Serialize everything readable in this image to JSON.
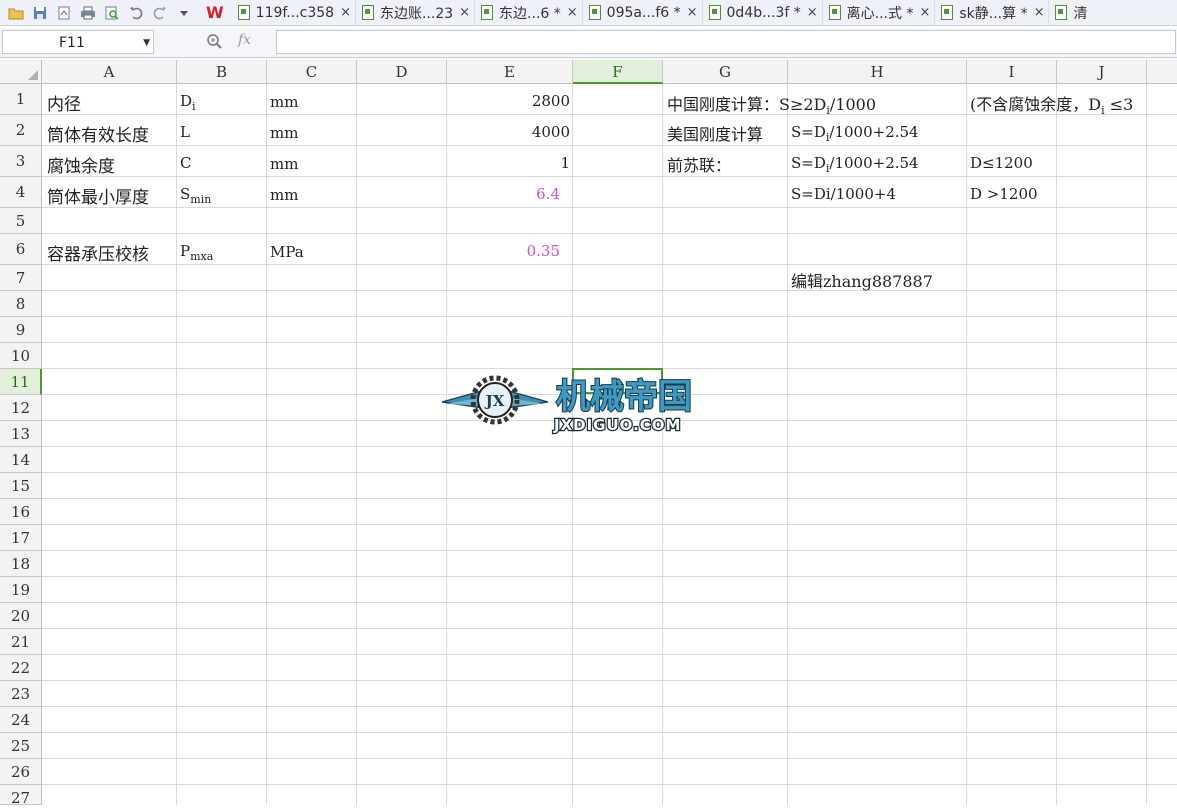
{
  "tabs": [
    {
      "label": "119f...c358",
      "close": "×"
    },
    {
      "label": "东边账...23",
      "close": "×"
    },
    {
      "label": "东边...6 *",
      "close": "×"
    },
    {
      "label": "095a...f6 *",
      "close": "×"
    },
    {
      "label": "0d4b...3f *",
      "close": "×"
    },
    {
      "label": "离心...式 *",
      "close": "×"
    },
    {
      "label": "sk静...算 *",
      "close": "×"
    },
    {
      "label": "清",
      "close": ""
    }
  ],
  "formula_bar": {
    "cell_ref": "F11",
    "fx_label": "fx",
    "value": ""
  },
  "columns": [
    "A",
    "B",
    "C",
    "D",
    "E",
    "F",
    "G",
    "H",
    "I",
    "J"
  ],
  "rows": [
    "1",
    "2",
    "3",
    "4",
    "5",
    "6",
    "7",
    "8",
    "9",
    "10",
    "11",
    "12",
    "13",
    "14",
    "15",
    "16",
    "17",
    "18",
    "19",
    "20",
    "21",
    "22",
    "23",
    "24",
    "25",
    "26",
    "27"
  ],
  "selected": {
    "column": "F",
    "row": "11"
  },
  "cells": {
    "A1": "内径",
    "B1_base": "D",
    "B1_sub": "i",
    "C1": "mm",
    "E1": "2800",
    "G1": "中国刚度计算：S≥2D",
    "G1_sub": "i",
    "G1_tail": "/1000",
    "I1": "(不含腐蚀余度，D",
    "I1_sub": "i",
    "I1_tail": " ≤3",
    "A2": "筒体有效长度",
    "B2": "L",
    "C2": "mm",
    "E2": "4000",
    "G2": "美国刚度计算",
    "H2": "S=D",
    "H2_sub": "i",
    "H2_tail": "/1000+2.54",
    "A3": "腐蚀余度",
    "B3": "C",
    "C3": "mm",
    "E3": "1",
    "G3": "前苏联：",
    "H3": "S=D",
    "H3_sub": "i",
    "H3_tail": "/1000+2.54",
    "I3": "D≤1200",
    "A4": "筒体最小厚度",
    "B4_base": "S",
    "B4_sub": "min",
    "C4": "mm",
    "E4": "6.4",
    "H4": "S=Di/1000+4",
    "I4": "D >1200",
    "A6": "容器承压校核",
    "B6_base": "P",
    "B6_sub": "mxa",
    "C6": "MPa",
    "E6": "0.35",
    "H7": "编辑zhang887887"
  },
  "watermark": {
    "cn": "机械帝国",
    "en": "JXDIGUO.COM",
    "badge": "JX"
  },
  "colors": {
    "magenta": "#d64bd6",
    "selection_green": "#4c9a2a",
    "wps_red": "#d61f26"
  }
}
